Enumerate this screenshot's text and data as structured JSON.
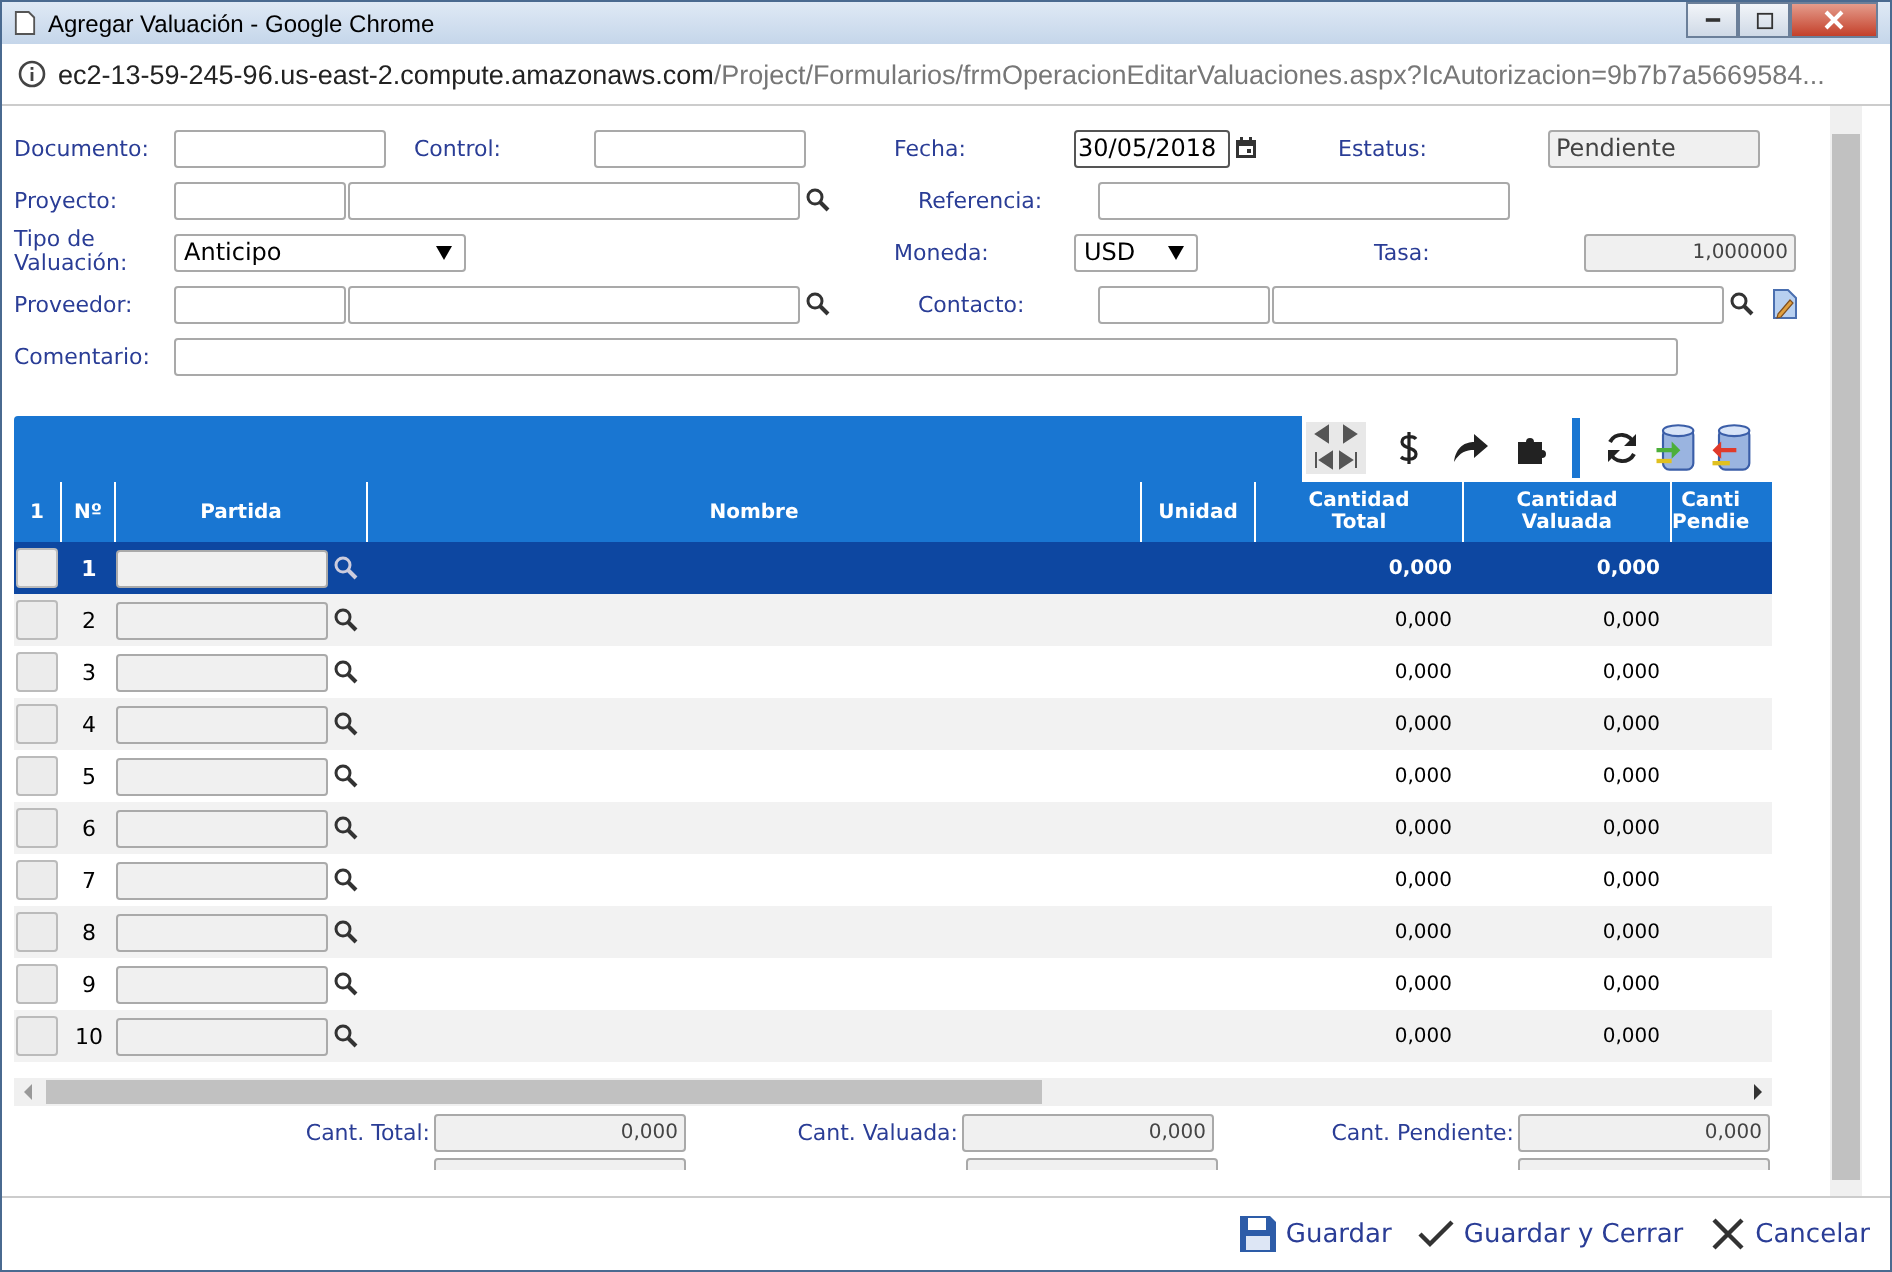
{
  "window": {
    "title": "Agregar Valuación - Google Chrome"
  },
  "url": {
    "host": "ec2-13-59-245-96.us-east-2.compute.amazonaws.com",
    "path": "/Project/Formularios/frmOperacionEditarValuaciones.aspx?IcAutorizacion=9b7b7a5669584..."
  },
  "form": {
    "documento": {
      "label": "Documento:"
    },
    "control": {
      "label": "Control:"
    },
    "fecha": {
      "label": "Fecha:",
      "value": "30/05/2018"
    },
    "estatus": {
      "label": "Estatus:",
      "value": "Pendiente"
    },
    "proyecto": {
      "label": "Proyecto:"
    },
    "referencia": {
      "label": "Referencia:"
    },
    "tipo": {
      "label": "Tipo de Valuación:",
      "value": "Anticipo"
    },
    "moneda": {
      "label": "Moneda:",
      "value": "USD"
    },
    "tasa": {
      "label": "Tasa:",
      "value": "1,000000"
    },
    "proveedor": {
      "label": "Proveedor:"
    },
    "contacto": {
      "label": "Contacto:"
    },
    "comentario": {
      "label": "Comentario:"
    }
  },
  "table": {
    "columns": [
      "1",
      "Nº",
      "Partida",
      "Nombre",
      "Unidad",
      "Cantidad\nTotal",
      "Cantidad\nValuada",
      "Canti\nPendie"
    ],
    "rows": [
      {
        "n": "1",
        "total": "0,000",
        "valuada": "0,000",
        "selected": true
      },
      {
        "n": "2",
        "total": "0,000",
        "valuada": "0,000",
        "selected": false
      },
      {
        "n": "3",
        "total": "0,000",
        "valuada": "0,000",
        "selected": false
      },
      {
        "n": "4",
        "total": "0,000",
        "valuada": "0,000",
        "selected": false
      },
      {
        "n": "5",
        "total": "0,000",
        "valuada": "0,000",
        "selected": false
      },
      {
        "n": "6",
        "total": "0,000",
        "valuada": "0,000",
        "selected": false
      },
      {
        "n": "7",
        "total": "0,000",
        "valuada": "0,000",
        "selected": false
      },
      {
        "n": "8",
        "total": "0,000",
        "valuada": "0,000",
        "selected": false
      },
      {
        "n": "9",
        "total": "0,000",
        "valuada": "0,000",
        "selected": false
      },
      {
        "n": "10",
        "total": "0,000",
        "valuada": "0,000",
        "selected": false
      }
    ]
  },
  "totals": [
    {
      "label": "Cant. Total:",
      "value": "0,000"
    },
    {
      "label": "Cant. Valuada:",
      "value": "0,000"
    },
    {
      "label": "Cant. Pendiente:",
      "value": "0,000"
    }
  ],
  "buttons": [
    {
      "kind": "save",
      "label": "Guardar"
    },
    {
      "kind": "check",
      "label": "Guardar y Cerrar"
    },
    {
      "kind": "cancel",
      "label": "Cancelar"
    }
  ]
}
